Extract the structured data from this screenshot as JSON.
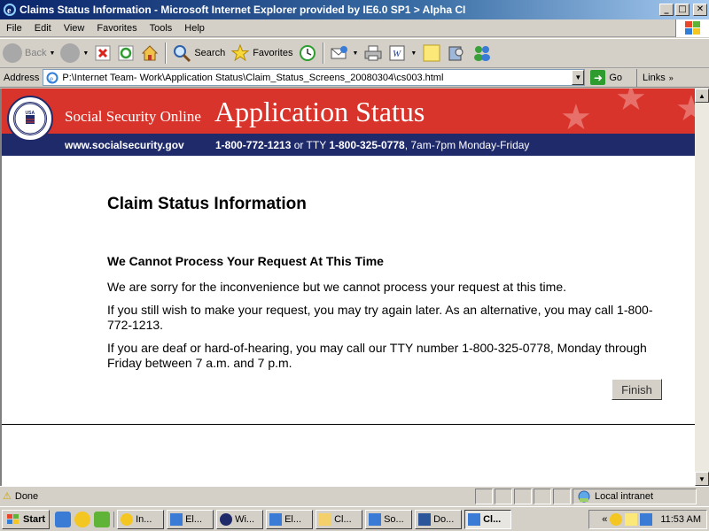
{
  "window": {
    "title": "Claims Status Information - Microsoft Internet Explorer provided by IE6.0 SP1 > Alpha CI",
    "minimize": "_",
    "maximize": "□",
    "close": "✕"
  },
  "menu": [
    "File",
    "Edit",
    "View",
    "Favorites",
    "Tools",
    "Help"
  ],
  "toolbar": {
    "back": "Back",
    "search": "Search",
    "favorites": "Favorites"
  },
  "address": {
    "label": "Address",
    "url": "P:\\Internet Team- Work\\Application Status\\Claim_Status_Screens_20080304\\cs003.html",
    "go": "Go",
    "links": "Links"
  },
  "banner": {
    "brand": "Social Security Online",
    "heading": "Application Status",
    "seal_text": "SOCIAL SECURITY ADMINISTRATION",
    "seal_center": "USA",
    "site": "www.socialsecurity.gov",
    "phone": "1-800-772-1213",
    "tty_prefix": " or TTY ",
    "tty": "1-800-325-0778",
    "hours": ", 7am-7pm Monday-Friday"
  },
  "page": {
    "title": "Claim Status Information",
    "subtitle": "We Cannot Process Your Request At This Time",
    "p1": "We are sorry for the inconvenience but we cannot process your request at this time.",
    "p2": "If you still wish to make your request, you may try again later. As an alternative, you may call 1-800-772-1213.",
    "p3": "If you are deaf or hard-of-hearing, you may call our TTY number 1-800-325-0778, Monday through Friday between 7 a.m. and 7 p.m.",
    "finish": "Finish"
  },
  "status": {
    "text": "Done",
    "zone": "Local intranet"
  },
  "taskbar": {
    "start": "Start",
    "tasks": [
      "In...",
      "El...",
      "Wi...",
      "El...",
      "Cl...",
      "So...",
      "Do...",
      "Cl..."
    ],
    "more": "«",
    "clock": "11:53 AM"
  }
}
